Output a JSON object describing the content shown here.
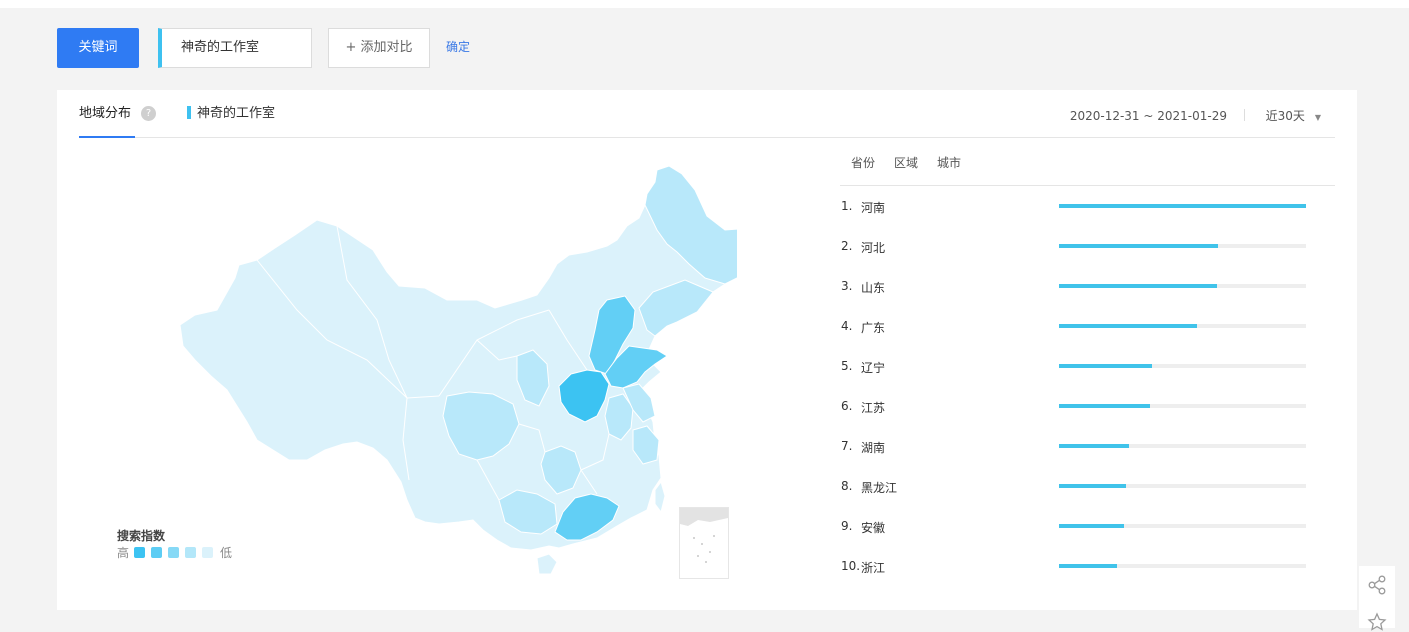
{
  "toolbar": {
    "keyword_label": "关键词",
    "keyword_value": "神奇的工作室",
    "add_compare_label": "+ 添加对比",
    "confirm_label": "确定"
  },
  "panel": {
    "tab_label": "地域分布",
    "help_icon": "?",
    "series_name": "神奇的工作室",
    "date_range": "2020-12-31 ~ 2021-01-29",
    "period": "近30天"
  },
  "legend": {
    "title": "搜索指数",
    "high": "高",
    "low": "低",
    "colors": [
      "#3cc3f2",
      "#5dcdf4",
      "#86d9f6",
      "#b3e7f9",
      "#dbf2fb"
    ]
  },
  "map_colors": {
    "lightest": "#dbf2fb",
    "light": "#b8e8fa",
    "mid": "#8ddbf7",
    "strong": "#62cff5",
    "top": "#3cc3f2"
  },
  "ranking": {
    "tabs": [
      "省份",
      "区域",
      "城市"
    ],
    "items": [
      {
        "rank": "1.",
        "name": "河南",
        "value": 1.0
      },
      {
        "rank": "2.",
        "name": "河北",
        "value": 0.645
      },
      {
        "rank": "3.",
        "name": "山东",
        "value": 0.64
      },
      {
        "rank": "4.",
        "name": "广东",
        "value": 0.56
      },
      {
        "rank": "5.",
        "name": "辽宁",
        "value": 0.375
      },
      {
        "rank": "6.",
        "name": "江苏",
        "value": 0.37
      },
      {
        "rank": "7.",
        "name": "湖南",
        "value": 0.285
      },
      {
        "rank": "8.",
        "name": "黑龙江",
        "value": 0.27
      },
      {
        "rank": "9.",
        "name": "安徽",
        "value": 0.265
      },
      {
        "rank": "10.",
        "name": "浙江",
        "value": 0.235
      }
    ]
  },
  "side_tools": [
    "share-icon",
    "star-icon"
  ]
}
